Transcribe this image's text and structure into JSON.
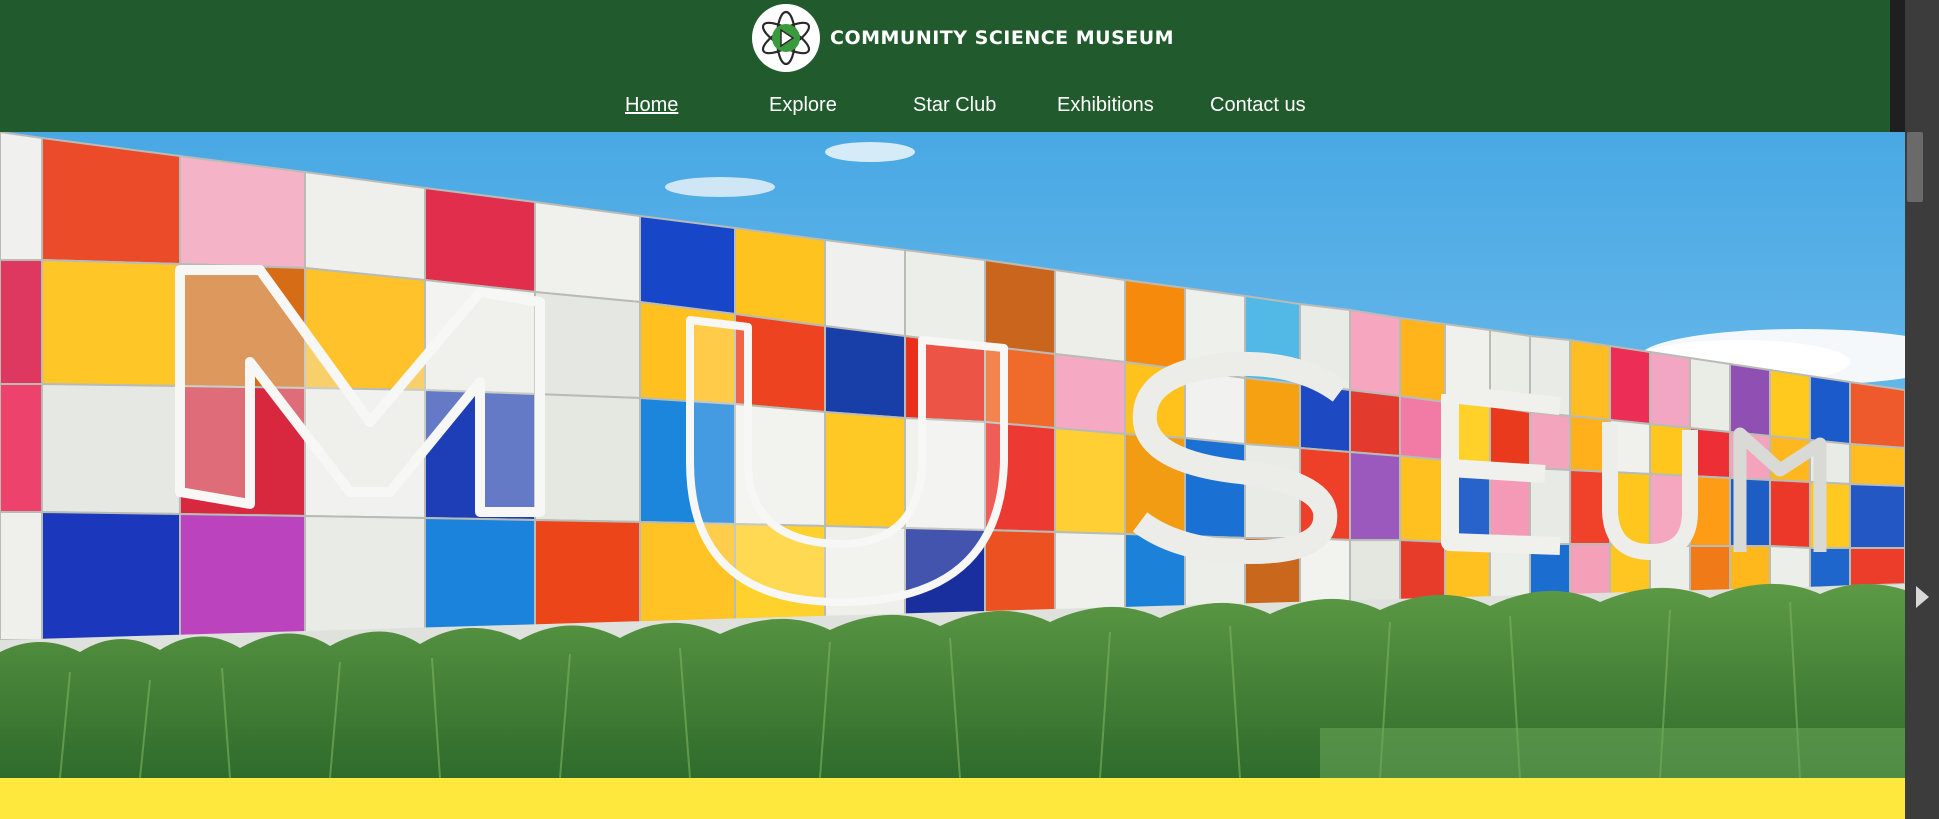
{
  "header": {
    "brand_name": "Community Science Museum",
    "logo": "atom-play-logo",
    "background": "#215a2c"
  },
  "nav": {
    "items": [
      {
        "label": "Home",
        "active": true
      },
      {
        "label": "Explore",
        "active": false
      },
      {
        "label": "Star Club",
        "active": false
      },
      {
        "label": "Exhibitions",
        "active": false
      },
      {
        "label": "Contact us",
        "active": false
      }
    ]
  },
  "hero": {
    "image": "colorful-museum-wall-photo",
    "sign_text": "MUSEUM"
  },
  "colors": {
    "accent_yellow": "#ffe83d",
    "sky": "#5aaee6",
    "grass": "#4a8a3a"
  },
  "icons": {
    "scroll_arrow": "chevron-right-icon"
  }
}
